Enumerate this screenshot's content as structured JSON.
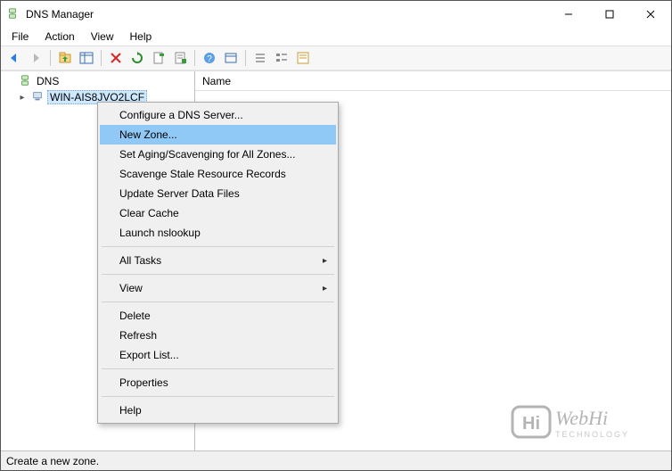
{
  "window": {
    "title": "DNS Manager"
  },
  "menu": {
    "file": "File",
    "action": "Action",
    "view": "View",
    "help": "Help"
  },
  "tree": {
    "root": "DNS",
    "server": "WIN-AIS8JVO2LCF"
  },
  "list": {
    "column_name": "Name"
  },
  "context_menu": {
    "configure": "Configure a DNS Server...",
    "new_zone": "New Zone...",
    "set_aging": "Set Aging/Scavenging for All Zones...",
    "scavenge": "Scavenge Stale Resource Records",
    "update": "Update Server Data Files",
    "clear_cache": "Clear Cache",
    "nslookup": "Launch nslookup",
    "all_tasks": "All Tasks",
    "view": "View",
    "delete": "Delete",
    "refresh": "Refresh",
    "export_list": "Export List...",
    "properties": "Properties",
    "help": "Help"
  },
  "status": {
    "text": "Create a new zone."
  },
  "watermark": {
    "line1": "WebHi",
    "line2": "TECHNOLOGY",
    "badge": "Hi"
  },
  "toolbar_icons": {
    "back": "back-icon",
    "forward": "forward-icon",
    "up": "up-icon",
    "show_hide": "show-hide-tree-icon",
    "delete": "delete-icon",
    "refresh": "refresh-icon",
    "export": "export-icon",
    "properties": "properties-icon",
    "help": "help-icon",
    "list1": "list-icon",
    "list2": "list-detail-icon",
    "list3": "list-large-icon"
  }
}
